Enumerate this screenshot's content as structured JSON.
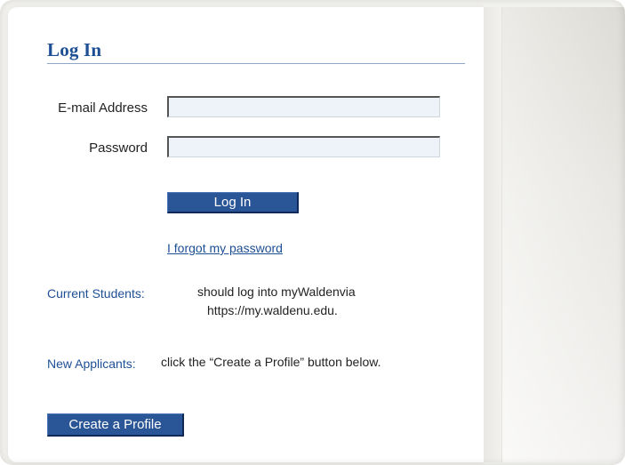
{
  "login": {
    "title": "Log In",
    "email_label": "E-mail Address",
    "email_value": "",
    "password_label": "Password",
    "password_value": "",
    "login_button": "Log In",
    "forgot_link": "I forgot my password"
  },
  "info": {
    "current_students_label": "Current Students:",
    "current_students_line1": "should log into myWaldenvia",
    "current_students_line2": "https://my.waldenu.edu.",
    "new_applicants_label": "New Applicants:",
    "new_applicants_text": "click the “Create a Profile” button below."
  },
  "actions": {
    "create_profile_button": "Create a Profile"
  },
  "colors": {
    "brand_blue": "#1d4f95",
    "button_blue": "#2a5596"
  }
}
